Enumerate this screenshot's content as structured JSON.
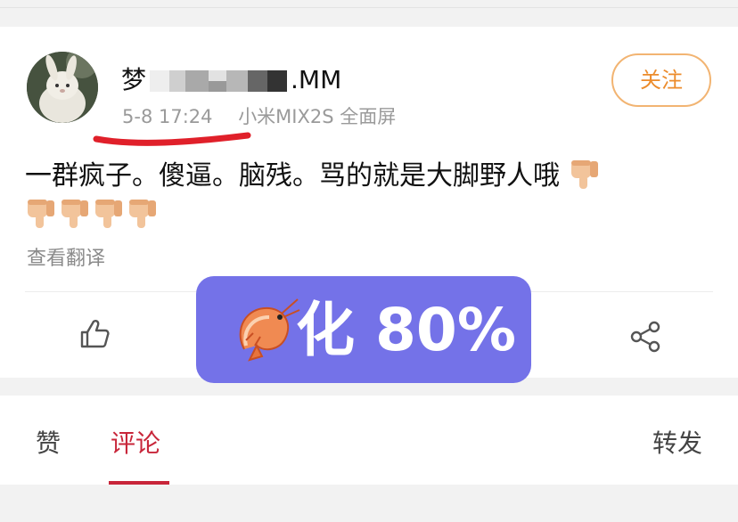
{
  "post": {
    "username_prefix": "梦",
    "username_suffix": ".MM",
    "timestamp": "5-8 17:24",
    "device": "小米MIX2S 全面屏",
    "follow_label": "关注",
    "text": "一群疯子。傻逼。脑残。骂的就是大脚野人哦",
    "trailing_emoji_count": 5,
    "translate_label": "查看翻译"
  },
  "overlay": {
    "label": "化 80%",
    "progress_percent": 80,
    "color": "#7472e8"
  },
  "tabs": [
    {
      "label": "赞",
      "active": false
    },
    {
      "label": "评论",
      "active": true
    },
    {
      "label": "转发",
      "active": false
    }
  ],
  "colors": {
    "accent_red": "#c8263a",
    "follow_orange": "#ec8c2c",
    "annotation_red": "#e0202a"
  },
  "icons": [
    "thumbs-up-icon",
    "share-icon",
    "thumbs-down-emoji",
    "shrimp-icon"
  ]
}
